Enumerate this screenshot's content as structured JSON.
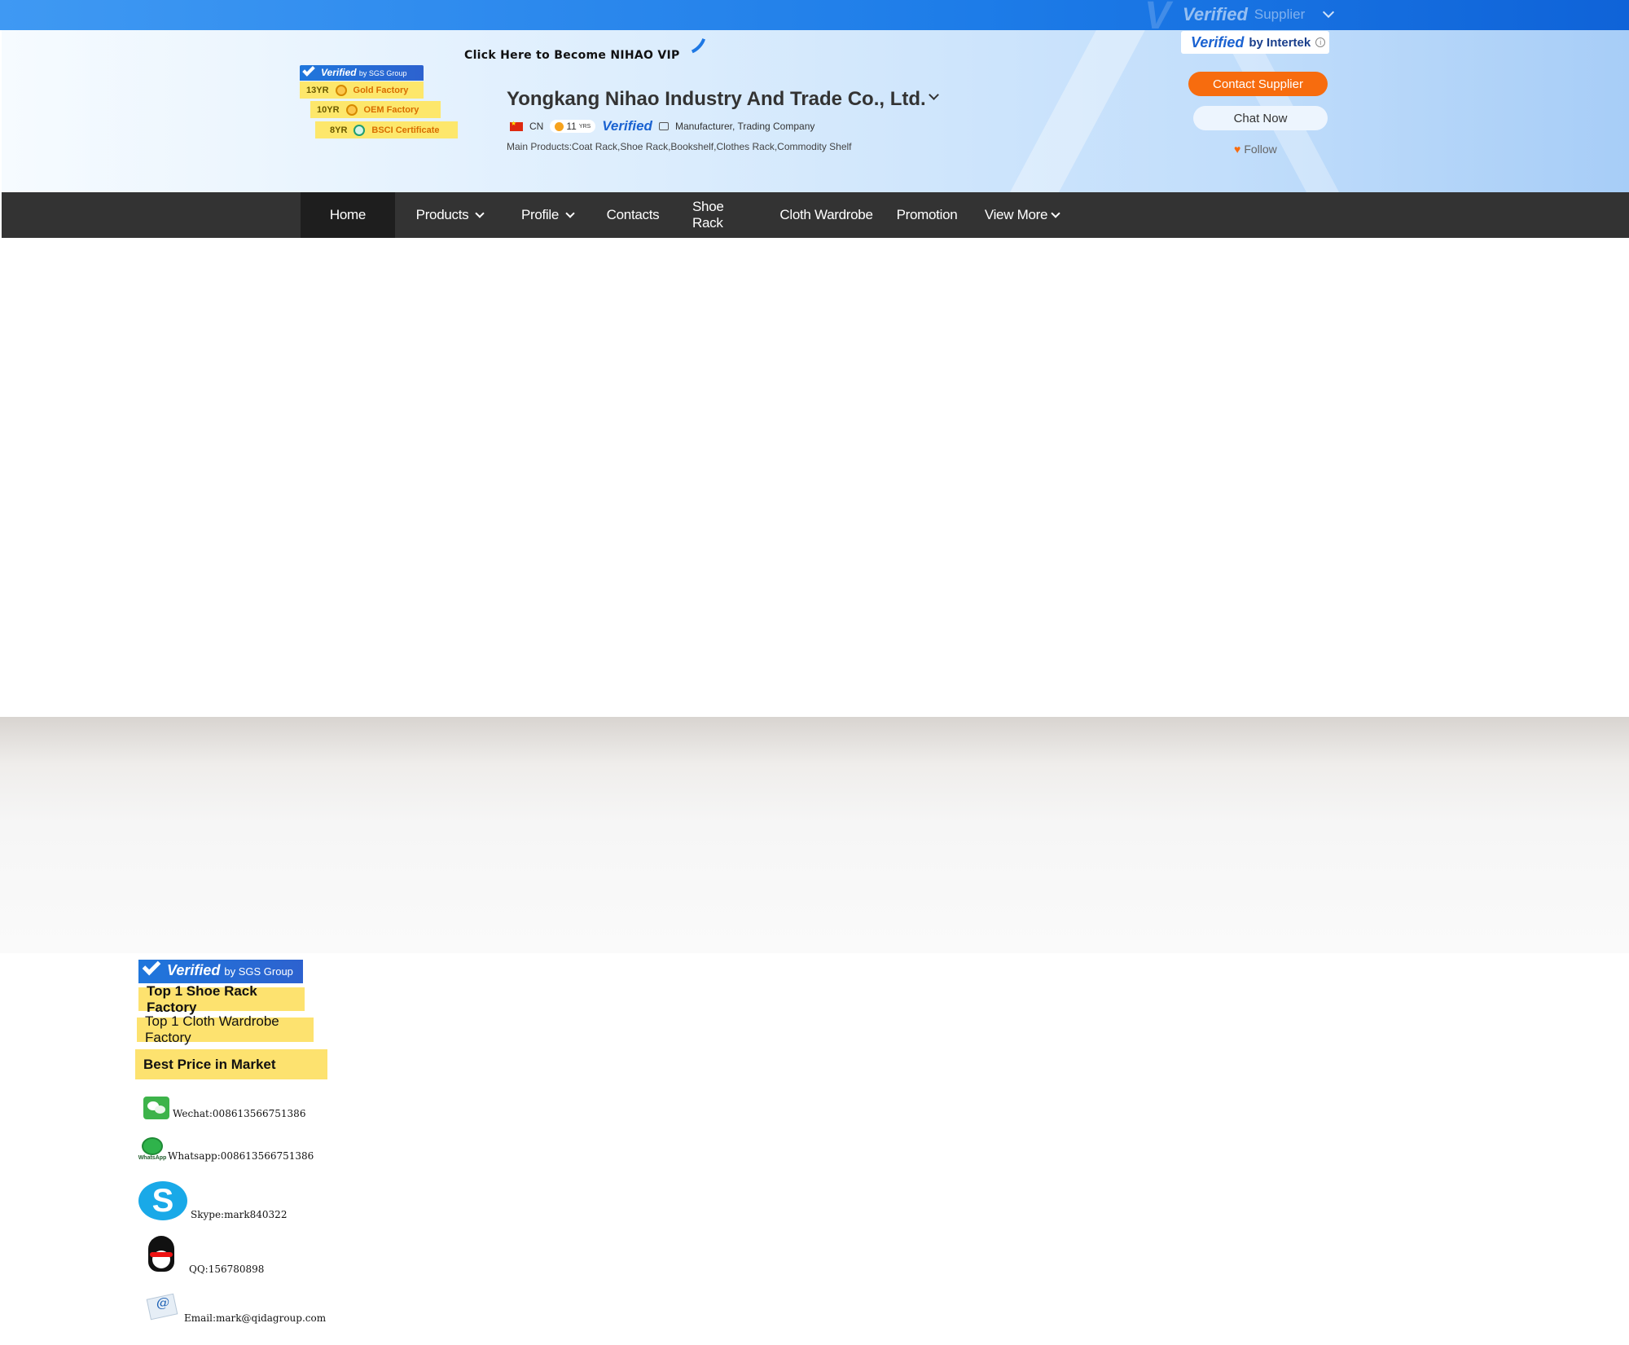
{
  "topbar": {
    "verified_label": "Verified",
    "supplier_label": "Supplier"
  },
  "header": {
    "sgs_badge": {
      "verified": "Verified",
      "by": "by SGS Group"
    },
    "badges": [
      {
        "years": "13YR",
        "label": "Gold Factory"
      },
      {
        "years": "10YR",
        "label": "OEM Factory"
      },
      {
        "years": "8YR",
        "label": "BSCI Certificate"
      }
    ],
    "vip_link": "Click Here to Become NIHAO VIP",
    "company_name": "Yongkang Nihao Industry And Trade Co., Ltd.",
    "country": "CN",
    "years": "11",
    "years_unit": "YRS",
    "verified": "Verified",
    "business_type": "Manufacturer, Trading Company",
    "main_products": "Main Products:Coat Rack,Shoe Rack,Bookshelf,Clothes Rack,Commodity Shelf",
    "intertek": {
      "verified": "Verified",
      "by": "by Intertek",
      "info": "i"
    },
    "contact_button": "Contact Supplier",
    "chat_button": "Chat Now",
    "follow_label": "Follow"
  },
  "nav": {
    "items": [
      {
        "label": "Home",
        "active": true
      },
      {
        "label": "Products",
        "dropdown": true
      },
      {
        "label": "Profile",
        "dropdown": true
      },
      {
        "label": "Contacts"
      },
      {
        "label": "Shoe Rack"
      },
      {
        "label": "Cloth Wardrobe"
      },
      {
        "label": "Promotion"
      },
      {
        "label": "View More",
        "dropdown": true
      }
    ]
  },
  "side": {
    "sgs": {
      "verified": "Verified",
      "by": "by SGS Group"
    },
    "labels": [
      "Top 1 Shoe Rack Factory",
      "Top 1 Cloth Wardrobe Factory",
      "Best Price in Market"
    ],
    "contacts": [
      {
        "icon": "wechat-icon",
        "text": "Wechat:008613566751386"
      },
      {
        "icon": "whatsapp-icon",
        "icon_caption": "WhatsApp",
        "text": "Whatsapp:008613566751386"
      },
      {
        "icon": "skype-icon",
        "icon_glyph": "S",
        "text": "Skype:mark840322"
      },
      {
        "icon": "qq-icon",
        "text": "QQ:156780898"
      },
      {
        "icon": "email-icon",
        "icon_glyph": "@",
        "text": "Email:mark@qidagroup.com"
      }
    ]
  },
  "colors": {
    "accent": "#f76c0e",
    "topbar": "#1d7ce8",
    "nav": "#333333",
    "badge": "#fde76b"
  }
}
